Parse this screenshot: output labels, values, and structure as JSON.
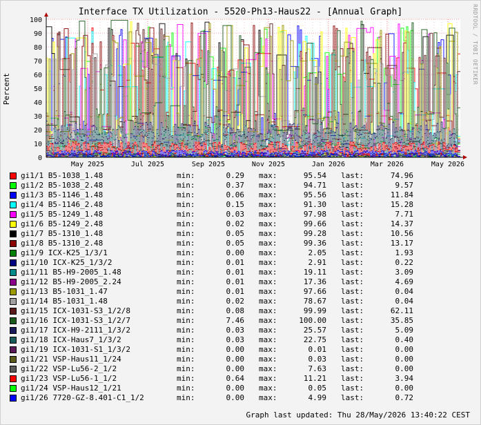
{
  "chart_data": {
    "type": "line",
    "title": "Interface TX Utilization - 5520-Ph13-Haus22 - [Annual Graph]",
    "ylabel": "Percent",
    "ylim": [
      0,
      100
    ],
    "yticks": [
      0,
      10,
      20,
      30,
      40,
      50,
      60,
      70,
      80,
      90,
      100
    ],
    "xticks": [
      "May 2025",
      "Jul 2025",
      "Sep 2025",
      "Nov 2025",
      "Jan 2026",
      "Mar 2026",
      "May 2026"
    ],
    "grid": true,
    "series": [
      {
        "name": "gi1/1 B5-1038_1.48",
        "color": "#ff0000",
        "min": "0.29",
        "max": "95.54",
        "last": "74.96"
      },
      {
        "name": "gi1/2 B5-1038_2.48",
        "color": "#00ff00",
        "min": "0.37",
        "max": "94.71",
        "last": "9.57"
      },
      {
        "name": "gi1/3 B5-1146_1.48",
        "color": "#0000ff",
        "min": "0.06",
        "max": "95.56",
        "last": "11.84"
      },
      {
        "name": "gi1/4 B5-1146_2.48",
        "color": "#00ffff",
        "min": "0.15",
        "max": "91.30",
        "last": "15.28"
      },
      {
        "name": "gi1/5 B5-1249_1.48",
        "color": "#ff00ff",
        "min": "0.03",
        "max": "97.98",
        "last": "7.71"
      },
      {
        "name": "gi1/6 B5-1249_2.48",
        "color": "#ffff00",
        "min": "0.02",
        "max": "99.66",
        "last": "14.37"
      },
      {
        "name": "gi1/7 B5-1310_1.48",
        "color": "#000000",
        "min": "0.05",
        "max": "99.28",
        "last": "10.56"
      },
      {
        "name": "gi1/8 B5-1310_2.48",
        "color": "#8b0000",
        "min": "0.05",
        "max": "99.36",
        "last": "13.17"
      },
      {
        "name": "gi1/9 ICX-K25_1/3/1",
        "color": "#008000",
        "min": "0.00",
        "max": "2.05",
        "last": "1.93"
      },
      {
        "name": "gi1/10 ICX-K25_1/3/2",
        "color": "#000080",
        "min": "0.01",
        "max": "2.91",
        "last": "0.22"
      },
      {
        "name": "gi1/11 B5-H9-2005_1.48",
        "color": "#008b8b",
        "min": "0.01",
        "max": "19.11",
        "last": "3.09"
      },
      {
        "name": "gi1/12 B5-H9-2005_2.24",
        "color": "#8b008b",
        "min": "0.01",
        "max": "17.36",
        "last": "4.69"
      },
      {
        "name": "gi1/13 B5-1031_1.47",
        "color": "#9a9a00",
        "min": "0.01",
        "max": "97.66",
        "last": "0.04"
      },
      {
        "name": "gi1/14 B5-1031_1.48",
        "color": "#a0a0a0",
        "min": "0.02",
        "max": "78.67",
        "last": "0.04"
      },
      {
        "name": "gi1/15 ICX-1031-S3_1/2/8",
        "color": "#5a1a1a",
        "min": "0.08",
        "max": "99.99",
        "last": "62.11"
      },
      {
        "name": "gi1/16 ICX-1031-S3_1/2/7",
        "color": "#1a5a1a",
        "min": "7.46",
        "max": "100.00",
        "last": "35.85"
      },
      {
        "name": "gi1/17 ICX-H9-2111_1/3/2",
        "color": "#1a1a5a",
        "min": "0.03",
        "max": "25.57",
        "last": "5.09"
      },
      {
        "name": "gi1/18 ICX-Haus7_1/3/2",
        "color": "#1a5a5a",
        "min": "0.03",
        "max": "22.75",
        "last": "0.40"
      },
      {
        "name": "gi1/19 ICX-1031-S1_1/3/2",
        "color": "#5a1a5a",
        "min": "0.00",
        "max": "0.01",
        "last": "0.00"
      },
      {
        "name": "gi1/21 VSP-Haus11_1/24",
        "color": "#5a5a1a",
        "min": "0.00",
        "max": "0.03",
        "last": "0.00"
      },
      {
        "name": "gi1/22 VSP-Lu56-2_1/2",
        "color": "#5a5a5a",
        "min": "0.00",
        "max": "7.63",
        "last": "0.00"
      },
      {
        "name": "gi1/23 VSP-Lu56-1_1/2",
        "color": "#ff0000",
        "min": "0.64",
        "max": "11.21",
        "last": "3.94"
      },
      {
        "name": "gi1/24 VSP-Haus12_1/21",
        "color": "#00ff00",
        "min": "0.00",
        "max": "0.05",
        "last": "0.00"
      },
      {
        "name": "gi1/26 7720-GZ-8.401-C1_1/2",
        "color": "#0000ff",
        "min": "0.00",
        "max": "4.99",
        "last": "0.72"
      }
    ]
  },
  "labels": {
    "min": "min:",
    "max": "max:",
    "last": "last:"
  },
  "side_label": "RRDTOOL / TOBI OETIKER",
  "footer": "Graph last updated: Thu 28/May/2026 13:40:22 CEST"
}
